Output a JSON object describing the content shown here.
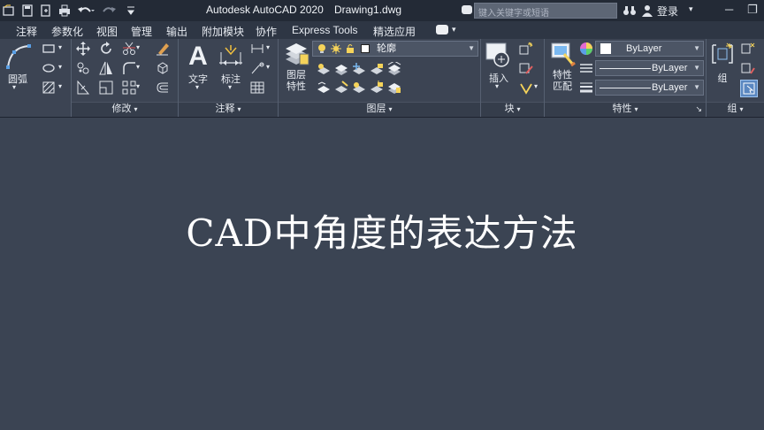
{
  "app": {
    "title": "Autodesk AutoCAD 2020",
    "document": "Drawing1.dwg",
    "search_placeholder": "键入关键字或短语",
    "login_label": "登录"
  },
  "tabs": [
    "注释",
    "参数化",
    "视图",
    "管理",
    "输出",
    "附加模块",
    "协作",
    "Express Tools",
    "精选应用"
  ],
  "panels": {
    "draw": {
      "arc_label": "圆弧"
    },
    "modify": {
      "title": "修改"
    },
    "annotation": {
      "title": "注释",
      "text_label": "文字",
      "dimension_label": "标注"
    },
    "layers": {
      "title": "图层",
      "layer_props_label": "图层\n特性",
      "current_layer": "轮廓"
    },
    "block": {
      "title": "块",
      "insert_label": "插入"
    },
    "properties": {
      "title": "特性",
      "match_label": "特性\n匹配",
      "color": "ByLayer",
      "linetype": "ByLayer",
      "lineweight": "ByLayer"
    },
    "groups": {
      "title": "组",
      "group_label": "组"
    }
  },
  "canvas": {
    "heading": "CAD中角度的表达方法"
  },
  "colors": {
    "titlebar": "#232a36",
    "ribbon": "#3c4453",
    "canvas": "#3b4453",
    "accent": "#ffd24a"
  }
}
